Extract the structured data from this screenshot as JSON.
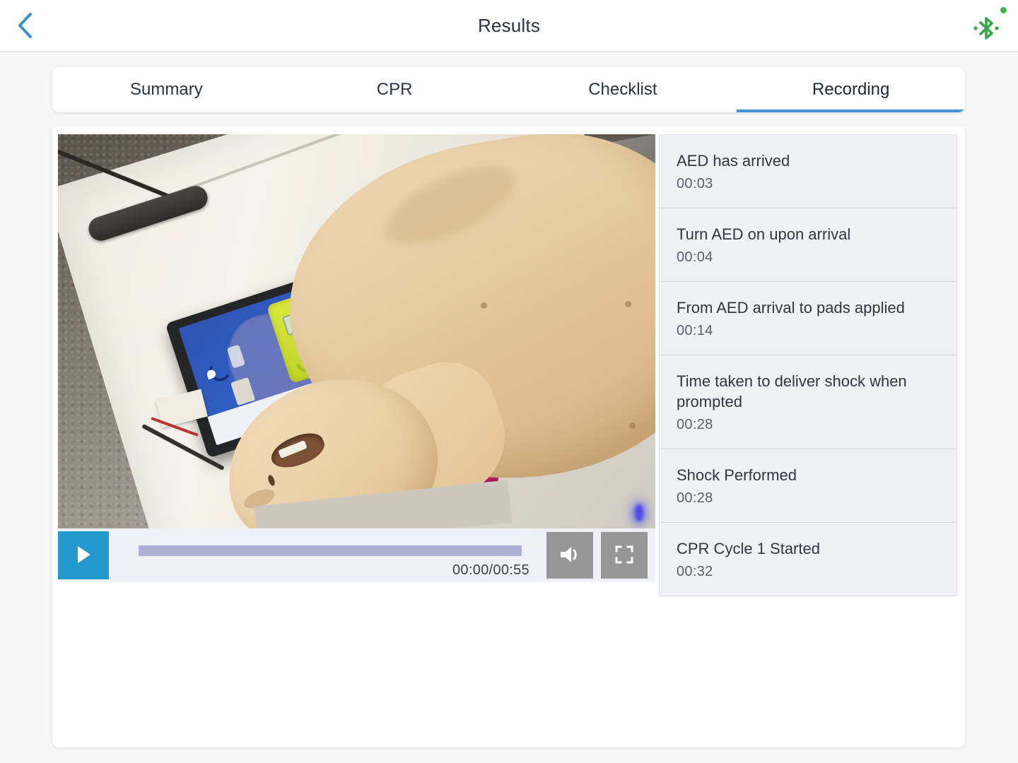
{
  "header": {
    "title": "Results",
    "back_icon": "chevron-left-icon",
    "bluetooth_icon": "bluetooth-icon",
    "bluetooth_status_color": "#3cb54a",
    "back_color": "#3a93c4"
  },
  "tabs": {
    "items": [
      {
        "label": "Summary",
        "active": false
      },
      {
        "label": "CPR",
        "active": false
      },
      {
        "label": "Checklist",
        "active": false
      },
      {
        "label": "Recording",
        "active": true
      }
    ],
    "active_underline_color": "#4a8fd4"
  },
  "player": {
    "play_icon": "play-icon",
    "volume_icon": "volume-icon",
    "fullscreen_icon": "fullscreen-icon",
    "time_display": "00:00/00:55",
    "current_time": "00:00",
    "duration": "00:55",
    "progress_percent": 0,
    "play_button_color": "#2399ce",
    "seek_track_color": "#adb0d3",
    "control_button_color": "#979797"
  },
  "video": {
    "description": "CPR training manikin lying on a white mat over grey carpet with a tablet showing an AED training app"
  },
  "events": [
    {
      "title": "AED has arrived",
      "time": "00:03"
    },
    {
      "title": "Turn AED on upon arrival",
      "time": "00:04"
    },
    {
      "title": "From AED arrival to pads applied",
      "time": "00:14"
    },
    {
      "title": "Time taken to deliver shock when prompted",
      "time": "00:28"
    },
    {
      "title": "Shock Performed",
      "time": "00:28"
    },
    {
      "title": "CPR Cycle 1 Started",
      "time": "00:32"
    }
  ]
}
